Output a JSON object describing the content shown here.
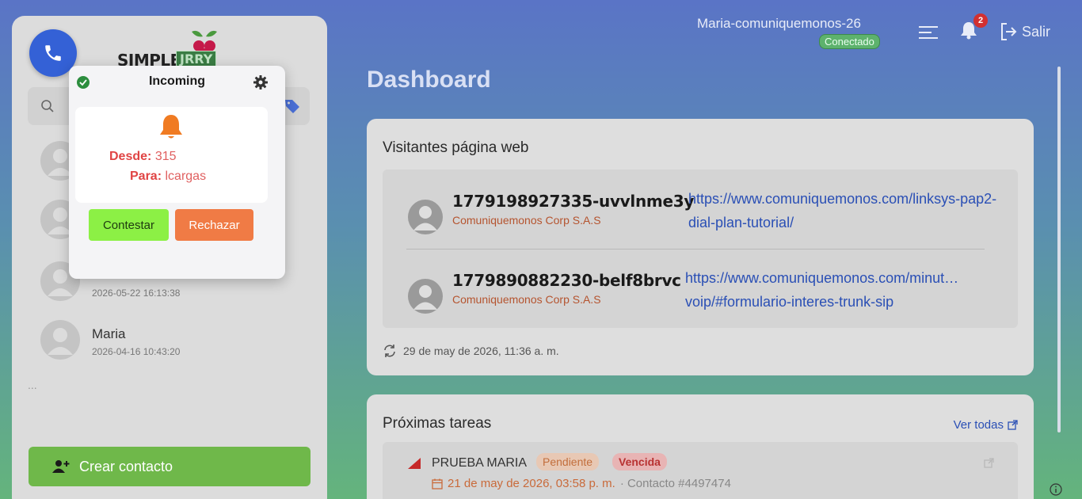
{
  "header": {
    "user_name": "Maria-comuniquemonos-26",
    "status": "Conectado",
    "notification_count": "2",
    "logout_label": "Salir"
  },
  "sidebar": {
    "logo_word": "SIMPLE",
    "logo_accent": "JRRY",
    "search_placeholder": "",
    "contacts": [
      {
        "name": "",
        "time": ""
      },
      {
        "name": "",
        "time": ""
      },
      {
        "name": "",
        "time": "2026-05-22 16:13:38"
      },
      {
        "name": "Maria",
        "time": "2026-04-16 10:43:20"
      }
    ],
    "more": "...",
    "create_contact_label": "Crear contacto"
  },
  "main": {
    "title": "Dashboard",
    "visitors": {
      "title": "Visitantes página web",
      "items": [
        {
          "id": "1779198927335-uvvlnme3y",
          "company": "Comuniquemonos Corp S.A.S",
          "url": "https://www.comuniquemonos.com/linksys-pap2-dial-plan-tutorial/"
        },
        {
          "id": "1779890882230-belf8brvc",
          "company": "Comuniquemonos Corp S.A.S",
          "url": "https://www.comuniquemonos.com/minut… voip/#formulario-interes-trunk-sip"
        }
      ],
      "updated": "29 de may de 2026, 11:36 a. m."
    },
    "tasks": {
      "title": "Próximas tareas",
      "see_all": "Ver todas",
      "items": [
        {
          "name": "PRUEBA MARIA",
          "status": "Pendiente",
          "due_status": "Vencida",
          "date": "21 de may de 2026, 03:58 p. m.",
          "contact": "· Contacto #4497474"
        }
      ]
    }
  },
  "popup": {
    "title": "Incoming",
    "from_label": "Desde:",
    "from_value": "315",
    "to_label": "Para:",
    "to_value": "lcargas",
    "answer_label": "Contestar",
    "reject_label": "Rechazar"
  },
  "colors": {
    "accent_blue": "#3461d6",
    "success_green": "#6fb84a",
    "answer_green": "#8cf045",
    "reject_orange": "#f07b45",
    "alert_red": "#d23030"
  }
}
